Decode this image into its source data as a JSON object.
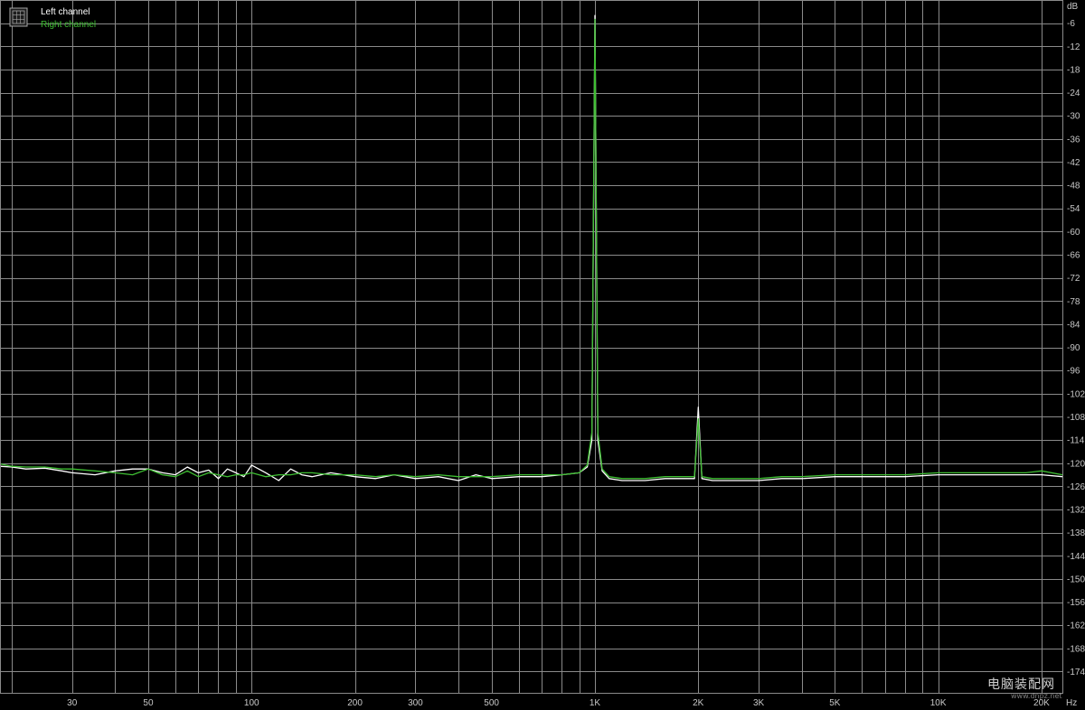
{
  "chart_data": {
    "type": "line",
    "y_unit": "dB",
    "x_unit": "Hz",
    "x_scale": "log",
    "xlim": [
      18.5,
      23000
    ],
    "ylim": [
      -179.5,
      0
    ],
    "grid": true,
    "legend_position": "top-left",
    "y_ticks": [
      -6,
      -12,
      -18,
      -24,
      -30,
      -36,
      -42,
      -48,
      -54,
      -60,
      -66,
      -72,
      -78,
      -84,
      -90,
      -96,
      -102,
      -108,
      -114,
      -120,
      -126,
      -132,
      -138,
      -144,
      -150,
      -156,
      -162,
      -168,
      -174
    ],
    "x_tick_labels": [
      {
        "value": 30,
        "label": "30"
      },
      {
        "value": 50,
        "label": "50"
      },
      {
        "value": 100,
        "label": "100"
      },
      {
        "value": 200,
        "label": "200"
      },
      {
        "value": 300,
        "label": "300"
      },
      {
        "value": 500,
        "label": "500"
      },
      {
        "value": 1000,
        "label": "1K"
      },
      {
        "value": 2000,
        "label": "2K"
      },
      {
        "value": 3000,
        "label": "3K"
      },
      {
        "value": 5000,
        "label": "5K"
      },
      {
        "value": 10000,
        "label": "10K"
      },
      {
        "value": 20000,
        "label": "20K"
      }
    ],
    "series": [
      {
        "name": "Left channel",
        "color": "#ffffff",
        "x": [
          18.5,
          20,
          22,
          25,
          28,
          30,
          35,
          40,
          45,
          50,
          55,
          60,
          65,
          70,
          75,
          80,
          85,
          90,
          95,
          100,
          110,
          120,
          130,
          140,
          150,
          170,
          200,
          230,
          260,
          300,
          350,
          400,
          450,
          500,
          600,
          700,
          800,
          900,
          950,
          980,
          1000,
          1020,
          1050,
          1100,
          1200,
          1400,
          1600,
          1800,
          1950,
          2000,
          2050,
          2200,
          2500,
          3000,
          3500,
          4000,
          5000,
          6000,
          7000,
          8000,
          10000,
          12000,
          14000,
          16000,
          18000,
          20000,
          23000
        ],
        "y": [
          -120.8,
          -121.0,
          -121.5,
          -121.3,
          -122.0,
          -122.5,
          -123.0,
          -122.0,
          -121.5,
          -121.5,
          -122.5,
          -123.0,
          -121.0,
          -122.5,
          -121.8,
          -124.0,
          -121.5,
          -122.5,
          -123.5,
          -120.5,
          -122.5,
          -124.5,
          -121.5,
          -123.0,
          -123.5,
          -122.5,
          -123.5,
          -124.0,
          -123.0,
          -124.0,
          -123.5,
          -124.5,
          -123.0,
          -124.0,
          -123.5,
          -123.5,
          -123.0,
          -122.5,
          -121.0,
          -114.0,
          -4.0,
          -114.0,
          -122.0,
          -124.0,
          -124.5,
          -124.5,
          -124.0,
          -124.0,
          -124.0,
          -105.5,
          -124.0,
          -124.5,
          -124.5,
          -124.5,
          -124.0,
          -124.0,
          -123.5,
          -123.5,
          -123.5,
          -123.5,
          -123.0,
          -123.0,
          -123.0,
          -123.0,
          -123.0,
          -123.0,
          -123.5
        ]
      },
      {
        "name": "Right channel",
        "color": "#3fbf33",
        "x": [
          18.5,
          20,
          22,
          25,
          28,
          30,
          35,
          40,
          45,
          50,
          55,
          60,
          65,
          70,
          75,
          80,
          85,
          90,
          95,
          100,
          110,
          120,
          130,
          140,
          150,
          170,
          200,
          230,
          260,
          300,
          350,
          400,
          450,
          500,
          600,
          700,
          800,
          900,
          950,
          980,
          1000,
          1020,
          1050,
          1100,
          1200,
          1400,
          1600,
          1800,
          1950,
          2000,
          2050,
          2200,
          2500,
          3000,
          3500,
          4000,
          5000,
          6000,
          7000,
          8000,
          10000,
          12000,
          14000,
          16000,
          18000,
          20000,
          23000
        ],
        "y": [
          -120.2,
          -120.8,
          -121.0,
          -121.0,
          -121.5,
          -121.5,
          -122.0,
          -122.5,
          -123.0,
          -121.5,
          -123.0,
          -123.5,
          -122.0,
          -123.5,
          -122.5,
          -123.0,
          -123.5,
          -123.0,
          -123.0,
          -122.5,
          -123.5,
          -123.0,
          -123.0,
          -122.5,
          -122.5,
          -123.0,
          -123.0,
          -123.5,
          -123.0,
          -123.5,
          -123.0,
          -123.5,
          -123.5,
          -123.5,
          -123.0,
          -123.0,
          -123.0,
          -122.5,
          -120.5,
          -112.0,
          -5.0,
          -112.0,
          -121.5,
          -123.5,
          -124.0,
          -124.0,
          -123.5,
          -123.5,
          -123.5,
          -108.5,
          -123.5,
          -124.0,
          -124.0,
          -124.0,
          -123.5,
          -123.5,
          -123.0,
          -123.0,
          -123.0,
          -123.0,
          -122.5,
          -122.5,
          -122.5,
          -122.5,
          -122.5,
          -122.0,
          -123.0
        ]
      }
    ]
  },
  "watermark": {
    "text": "电脑装配网",
    "subtext": "www.dnpz.net"
  }
}
